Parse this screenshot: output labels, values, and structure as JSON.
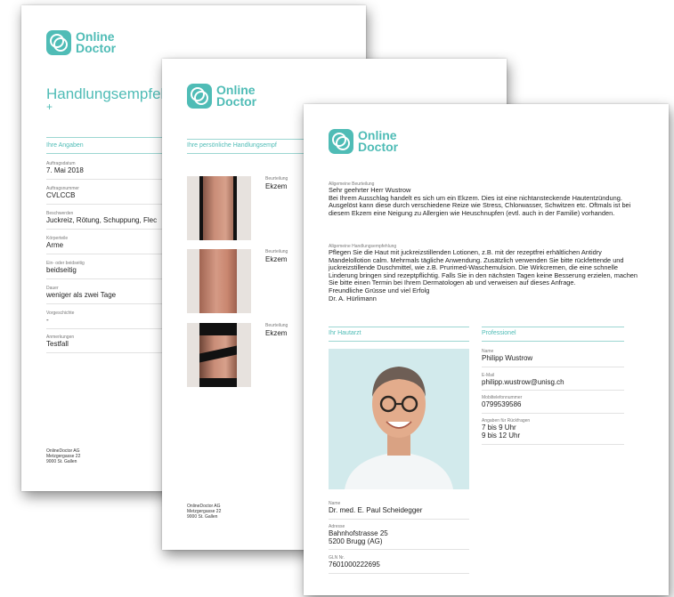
{
  "brand": {
    "line1": "Online",
    "line2": "Doctor"
  },
  "page1": {
    "title": "Handlungsempfeh",
    "title_extra": "+",
    "section": "Ihre Angaben",
    "fields": [
      {
        "label": "Auftragsdatum",
        "value": "7. Mai 2018"
      },
      {
        "label": "Auftragsnummer",
        "value": "CVLCCB"
      },
      {
        "label": "Beschwerden",
        "value": "Juckreiz, Rötung, Schuppung, Flec"
      },
      {
        "label": "Körperteile",
        "value": "Arme"
      },
      {
        "label": "Ein- oder beidseitig",
        "value": "beidseitig"
      },
      {
        "label": "Dauer",
        "value": "weniger als zwei Tage"
      },
      {
        "label": "Vorgeschichte",
        "value": "-"
      },
      {
        "label": "Anmerkungen",
        "value": "Testfall"
      }
    ],
    "footer": [
      "OnlineDoctor AG",
      "Metzgergasse 22",
      "9000 St. Gallen"
    ]
  },
  "page2": {
    "section": "Ihre persönliche Handlungsempf",
    "images": [
      {
        "label": "Beurteilung",
        "value": "Ekzem"
      },
      {
        "label": "Beurteilung",
        "value": "Ekzem"
      },
      {
        "label": "Beurteilung",
        "value": "Ekzem"
      }
    ],
    "footer": [
      "OnlineDoctor AG",
      "Metzgergasse 22",
      "9000 St. Gallen"
    ]
  },
  "page3": {
    "assessment_label": "Allgemeine Beurteilung",
    "assessment_text": "Sehr geehrter Herr Wustrow\nBei Ihrem Ausschlag handelt es sich um ein Ekzem. Dies ist eine nichtansteckende Hautentzündung. Ausgelöst kann diese durch verschiedene Reize wie Stress, Chlorwasser, Schwitzen etc. Oftmals ist bei diesem Ekzem eine Neigung zu Allergien wie Heuschnupfen (evtl. auch in der Familie) vorhanden.",
    "recommendation_label": "Allgemeine Handlungsempfehlung",
    "recommendation_text": "Pflegen Sie die Haut mit juckreizstillenden Lotionen, z.B. mit der rezeptfrei erhältlichen Antidry Mandelollotion calm. Mehrmals tägliche Anwendung. Zusätzlich verwenden Sie bitte rückfettende und juckreizstillende Duschmittel, wie z.B. Prurimed-Waschemulsion. Die Wirkcremen, die eine schnelle Linderung bringen sind rezeptpflichtig. Falls Sie in den nächsten Tagen keine Besserung erzielen, machen Sie bitte einen Termin bei Ihrem Dermatologen ab und verweisen auf dieses Anfrage.\nFreundliche Grüsse und viel Erfolg\nDr. A. Hürlimann",
    "doctor_section": "Ihr Hautarzt",
    "professional_section": "Professionel",
    "doctor_fields": [
      {
        "label": "Name",
        "value": "Dr. med. E. Paul Scheidegger"
      },
      {
        "label": "Adresse",
        "value": "Bahnhofstrasse 25\n5200 Brugg (AG)"
      },
      {
        "label": "GLN Nr.",
        "value": "7601000222695"
      }
    ],
    "professional_fields": [
      {
        "label": "Name",
        "value": "Philipp Wustrow"
      },
      {
        "label": "E-Mail",
        "value": "philipp.wustrow@unisg.ch"
      },
      {
        "label": "Mobiltelefonnummer",
        "value": "0799539586"
      },
      {
        "label": "Angaben für Rückfragen",
        "value": "7 bis 9 Uhr\n9 bis 12 Uhr"
      }
    ]
  }
}
